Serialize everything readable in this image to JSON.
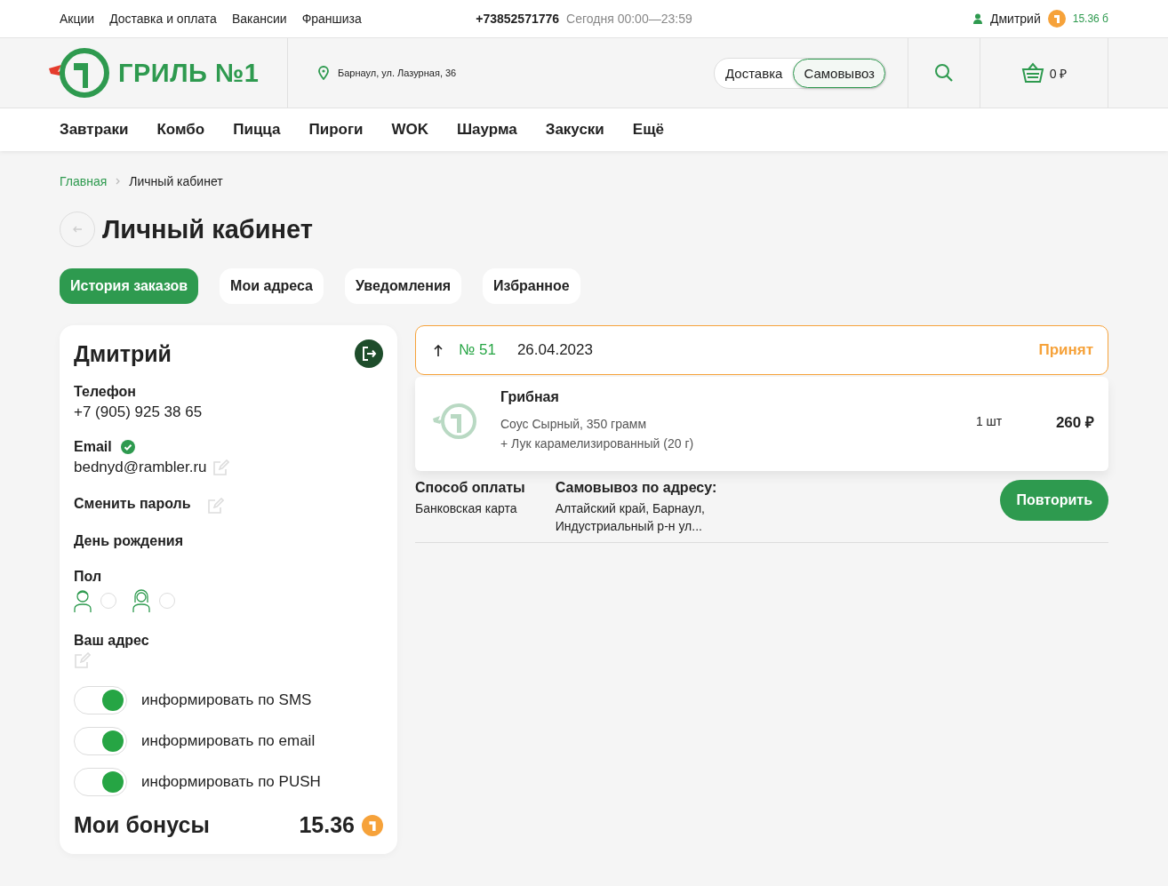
{
  "top_bar": {
    "links": [
      "Акции",
      "Доставка и оплата",
      "Вакансии",
      "Франшиза"
    ],
    "phone": "+73852571776",
    "hours": "Сегодня 00:00—23:59",
    "user_name": "Дмитрий",
    "bonus": "15.36 б"
  },
  "header": {
    "logo_text": "ГРИЛЬ №1",
    "address": "Барнаул, ул. Лазурная, 36",
    "delivery_modes": [
      {
        "label": "Доставка",
        "selected": false
      },
      {
        "label": "Самовывоз",
        "selected": true
      }
    ],
    "cart": "0 ₽"
  },
  "nav": [
    "Завтраки",
    "Комбо",
    "Пицца",
    "Пироги",
    "WOK",
    "Шаурма",
    "Закуски",
    "Ещё"
  ],
  "breadcrumbs": [
    "Главная",
    "Личный кабинет"
  ],
  "page_title": "Личный кабинет",
  "tabs": [
    {
      "label": "История заказов",
      "selected": true
    },
    {
      "label": "Мои адреса",
      "selected": false
    },
    {
      "label": "Уведомления",
      "selected": false
    },
    {
      "label": "Избранное",
      "selected": false
    }
  ],
  "profile": {
    "name": "Дмитрий",
    "phone_label": "Телефон",
    "phone": "+7 (905) 925 38 65",
    "email_label": "Email",
    "email_verified": true,
    "email": "bednyd@rambler.ru",
    "password_label": "Сменить пароль",
    "birthday_label": "День рождения",
    "gender_label": "Пол",
    "genders": [
      {
        "kind": "male",
        "selected": false
      },
      {
        "kind": "female",
        "selected": false
      }
    ],
    "address_label": "Ваш адрес",
    "notifications": [
      {
        "label": "информировать по SMS",
        "on": true
      },
      {
        "label": "информировать по email",
        "on": true
      },
      {
        "label": "информировать по PUSH",
        "on": true
      }
    ],
    "bonus_label": "Мои бонусы",
    "bonus": "15.36"
  },
  "order": {
    "number": "№ 51",
    "date": "26.04.2023",
    "status": "Принят",
    "expanded": true,
    "items": [
      {
        "name": "Грибная",
        "options": [
          "Соус Сырный, 350 грамм",
          "+ Лук карамелизированный (20 г)"
        ],
        "qty": "1 шт",
        "price": "260 ₽"
      }
    ],
    "payment_label": "Способ оплаты",
    "payment": "Банковская карта",
    "pickup_label": "Самовывоз по адресу:",
    "pickup_address": "Алтайский край, Барнаул, Индустриальный р-н ул...",
    "repeat_button": "Повторить"
  }
}
